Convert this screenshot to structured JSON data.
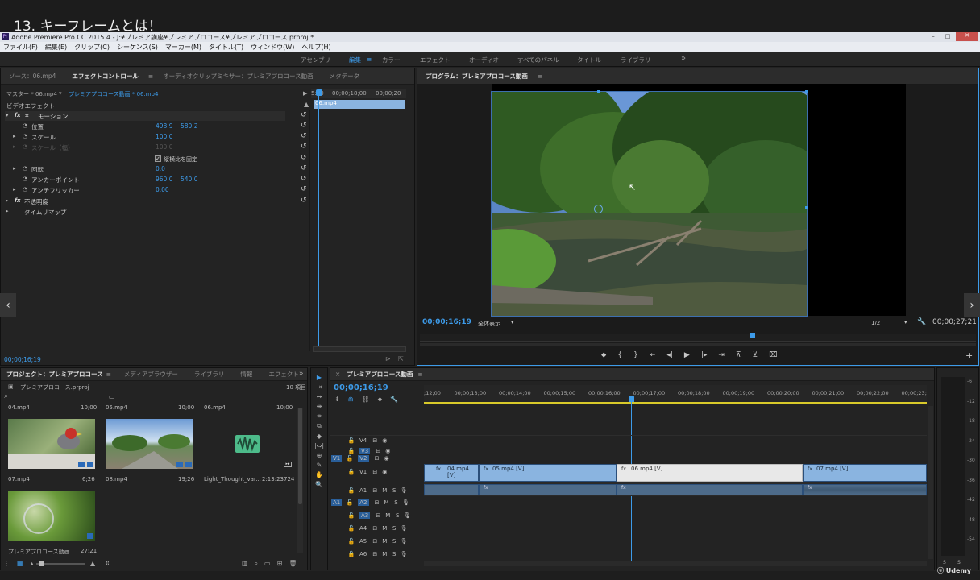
{
  "overlay_title": "13. キーフレームとは！",
  "window": {
    "title": "Adobe Premiere Pro CC 2015.4 - J:¥プレミア講座¥プレミアプロコース¥プレミアプロコース.prproj *",
    "controls": [
      "–",
      "□",
      "✕"
    ]
  },
  "menu": [
    "ファイル(F)",
    "編集(E)",
    "クリップ(C)",
    "シーケンス(S)",
    "マーカー(M)",
    "タイトル(T)",
    "ウィンドウ(W)",
    "ヘルプ(H)"
  ],
  "workspaces": {
    "items": [
      "アセンブリ",
      "編集",
      "カラー",
      "エフェクト",
      "オーディオ",
      "すべてのパネル",
      "タイトル",
      "ライブラリ"
    ],
    "active": "編集",
    "more": "»"
  },
  "source_panel": {
    "tabs": [
      "ソース：06.mp4",
      "エフェクトコントロール",
      "オーディオクリップミキサー：プレミアプロコース動画",
      "メタデータ"
    ],
    "active_tab": "エフェクトコントロール",
    "menu_icon": "≡"
  },
  "effect_controls": {
    "master": "マスター * 06.mp4",
    "clip_sel": "プレミアプロコース動画 * 06.mp4",
    "mini_ruler": [
      "5:00",
      "00;00;18;00",
      "00;00;20"
    ],
    "clip_label": "06.mp4",
    "video_effects": "ビデオエフェクト",
    "fx": "fx",
    "motion": "モーション",
    "rows": [
      {
        "label": "位置",
        "v1": "498.9",
        "v2": "580.2"
      },
      {
        "label": "スケール",
        "v1": "100.0",
        "v2": ""
      },
      {
        "label": "スケール（幅）",
        "v1": "100.0",
        "v2": ""
      },
      {
        "label": "縦横比を固定",
        "v1": "",
        "v2": ""
      },
      {
        "label": "回転",
        "v1": "0.0",
        "v2": ""
      },
      {
        "label": "アンカーポイント",
        "v1": "960.0",
        "v2": "540.0"
      },
      {
        "label": "アンチフリッカー",
        "v1": "0.00",
        "v2": ""
      }
    ],
    "opacity": "不透明度",
    "time_remap": "タイムリマップ",
    "timecode": "00;00;16;19",
    "reset": "↺"
  },
  "program": {
    "tab": "プログラム：プレミアプロコース動画",
    "timecode": "00;00;16;19",
    "fit": "全体表示",
    "quality": "1/2",
    "duration": "00;00;27;21"
  },
  "project": {
    "tabs": [
      "プロジェクト：プレミアプロコース",
      "メディアブラウザー",
      "ライブラリ",
      "情報",
      "エフェクト"
    ],
    "file": "プレミアプロコース.prproj",
    "count": "10 項目",
    "search_icon": "⌕",
    "row_labels": [
      {
        "name": "04.mp4",
        "dur": "10;00"
      },
      {
        "name": "05.mp4",
        "dur": "10;00"
      },
      {
        "name": "06.mp4",
        "dur": "10;00"
      }
    ],
    "items": [
      {
        "name": "07.mp4",
        "dur": "6;26"
      },
      {
        "name": "08.mp4",
        "dur": "19;26"
      },
      {
        "name": "Light_Thought_var...",
        "dur": "2:13:23724"
      },
      {
        "name": "プレミアプロコース動画",
        "dur": "27;21"
      }
    ]
  },
  "tools": [
    "▶",
    "⇥",
    "↔",
    "⇹",
    "⇼",
    "⧉",
    "◆",
    "|⇔|",
    "⊕",
    "✎",
    "✋",
    "🔍"
  ],
  "timeline": {
    "tab": "プレミアプロコース動画",
    "timecode": "00;00;16;19",
    "ruler": [
      ";12;00",
      "00;00;13;00",
      "00;00;14;00",
      "00;00;15;00",
      "00;00;16;00",
      "00;00;17;00",
      "00;00;18;00",
      "00;00;19;00",
      "00;00;20;00",
      "00;00;21;00",
      "00;00;22;00",
      "00;00;23;"
    ],
    "video_tracks": [
      "V4",
      "V3",
      "V2",
      "V1"
    ],
    "audio_tracks": [
      "A1",
      "A2",
      "A3",
      "A4",
      "A5",
      "A6"
    ],
    "src_v": "V1",
    "src_a": "A1",
    "clips": [
      {
        "name": "04.mp4 [V]"
      },
      {
        "name": "05.mp4 [V]"
      },
      {
        "name": "06.mp4 [V]"
      },
      {
        "name": "07.mp4 [V]"
      }
    ],
    "fx_badge": "fx",
    "meter_labels": [
      "-6",
      "-12",
      "-18",
      "-24",
      "-30",
      "-36",
      "-42",
      "-48",
      "-54"
    ],
    "meter_bottom": [
      "S",
      "S"
    ]
  },
  "watermark": "Udemy",
  "colors": {
    "accent": "#3d9be9",
    "clip_blue": "#8ab4e0",
    "clip_selected": "#e8e8e8",
    "playhead": "#3d9be9",
    "work_area": "#e8d833"
  }
}
